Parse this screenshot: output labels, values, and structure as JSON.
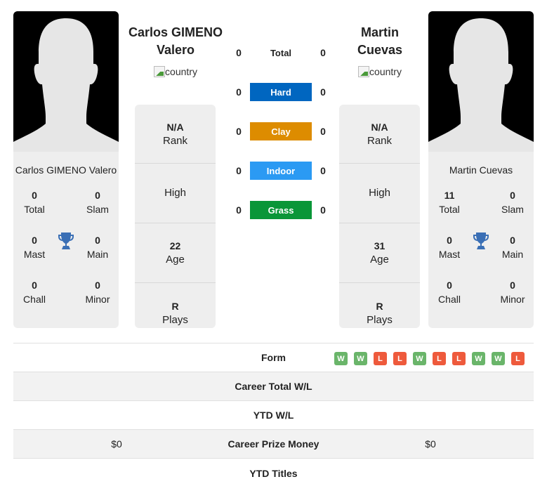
{
  "players": [
    {
      "name_line1": "Carlos GIMENO",
      "name_line2": "Valero",
      "full_name": "Carlos GIMENO Valero",
      "flag_alt": "country",
      "info": {
        "rank_value": "N/A",
        "rank_label": "Rank",
        "high_label": "High",
        "age_value": "22",
        "age_label": "Age",
        "plays_value": "R",
        "plays_label": "Plays"
      },
      "titles": {
        "total": "0",
        "total_label": "Total",
        "slam": "0",
        "slam_label": "Slam",
        "mast": "0",
        "mast_label": "Mast",
        "main": "0",
        "main_label": "Main",
        "chall": "0",
        "chall_label": "Chall",
        "minor": "0",
        "minor_label": "Minor"
      }
    },
    {
      "name_line1": "Martin",
      "name_line2": "Cuevas",
      "full_name": "Martin Cuevas",
      "flag_alt": "country",
      "info": {
        "rank_value": "N/A",
        "rank_label": "Rank",
        "high_label": "High",
        "age_value": "31",
        "age_label": "Age",
        "plays_value": "R",
        "plays_label": "Plays"
      },
      "titles": {
        "total": "11",
        "total_label": "Total",
        "slam": "0",
        "slam_label": "Slam",
        "mast": "0",
        "mast_label": "Mast",
        "main": "0",
        "main_label": "Main",
        "chall": "0",
        "chall_label": "Chall",
        "minor": "0",
        "minor_label": "Minor"
      }
    }
  ],
  "surfaces": [
    {
      "label": "Total",
      "left": "0",
      "right": "0",
      "color": ""
    },
    {
      "label": "Hard",
      "left": "0",
      "right": "0",
      "color": "#0066c0"
    },
    {
      "label": "Clay",
      "left": "0",
      "right": "0",
      "color": "#dd8c00"
    },
    {
      "label": "Indoor",
      "left": "0",
      "right": "0",
      "color": "#2b9af3"
    },
    {
      "label": "Grass",
      "left": "0",
      "right": "0",
      "color": "#0a9638"
    }
  ],
  "form": {
    "label": "Form",
    "results": [
      "W",
      "W",
      "L",
      "L",
      "W",
      "L",
      "L",
      "W",
      "W",
      "L"
    ],
    "win_color": "#6ab56a",
    "loss_color": "#ee5a3c"
  },
  "stats_rows": [
    {
      "label": "Career Total W/L",
      "left": "",
      "right": ""
    },
    {
      "label": "YTD W/L",
      "left": "",
      "right": ""
    },
    {
      "label": "Career Prize Money",
      "left": "$0",
      "right": "$0"
    },
    {
      "label": "YTD Titles",
      "left": "",
      "right": ""
    }
  ]
}
